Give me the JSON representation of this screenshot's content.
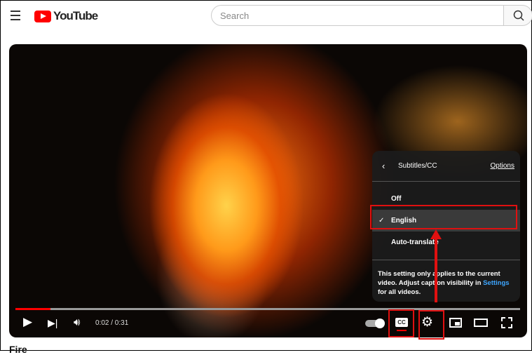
{
  "header": {
    "logo": "YouTube",
    "search_placeholder": "Search"
  },
  "captions_menu": {
    "title": "Subtitles/CC",
    "options_link": "Options",
    "items": [
      {
        "label": "Off"
      },
      {
        "label": "English",
        "selected": true
      },
      {
        "label": "Auto-translate"
      }
    ],
    "note_prefix": "This setting only applies to the current video. Adjust caption visibility in ",
    "note_link": "Settings",
    "note_suffix": " for all videos."
  },
  "player": {
    "time": "0:02 / 0:31",
    "progress_fraction": 0.07,
    "accent": "#ff0000"
  },
  "video_title": "Fire"
}
